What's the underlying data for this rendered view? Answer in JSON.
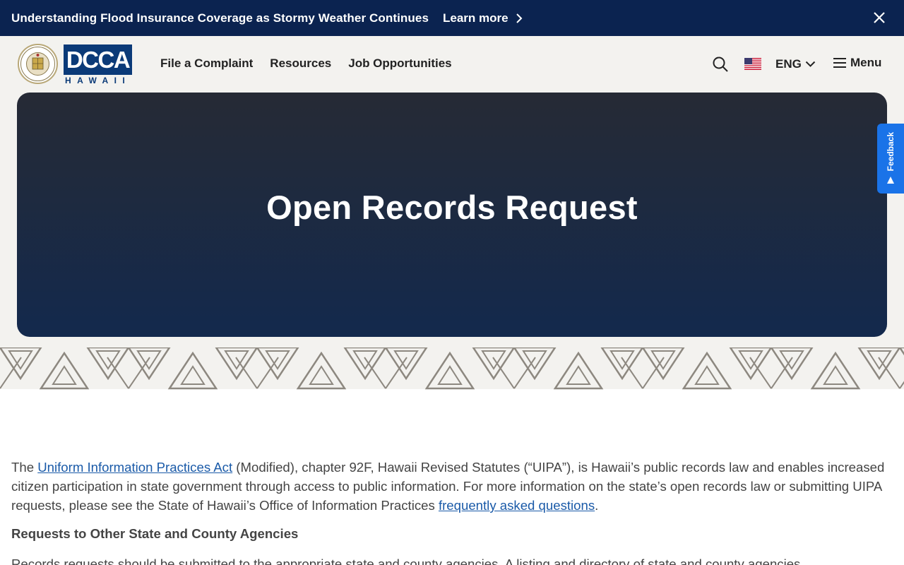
{
  "alert": {
    "text": "Understanding Flood Insurance Coverage as Stormy Weather Continues",
    "link_label": "Learn more"
  },
  "header": {
    "logo_text": "DCCA",
    "logo_sub": "HAWAII",
    "nav": [
      "File a Complaint",
      "Resources",
      "Job Opportunities"
    ],
    "lang_label": "ENG",
    "menu_label": "Menu"
  },
  "hero": {
    "title": "Open Records Request"
  },
  "feedback": {
    "label": "Feedback"
  },
  "content": {
    "p1_before": "The ",
    "p1_link": "Uniform Information Practices Act",
    "p1_middle": " (Modified), chapter 92F, Hawaii Revised Statutes (“UIPA”), is Hawaii’s public records law and enables increased citizen participation in state government through access to public information. For more information on the state’s open records law or submitting UIPA requests, please see the State of Hawaii’s Office of Information Practices ",
    "p1_link2": "frequently asked questions",
    "p1_after": ".",
    "subheading": "Requests to Other State and County Agencies",
    "p2": "Records requests should be submitted to the appropriate state and county agencies. A listing and directory of state and county agencies"
  },
  "colors": {
    "banner": "#0b2350",
    "header_bg": "#f3f2ef",
    "logo_blue": "#0b3a78",
    "link_blue": "#1a5aa8",
    "feedback_blue": "#1a73e8"
  }
}
